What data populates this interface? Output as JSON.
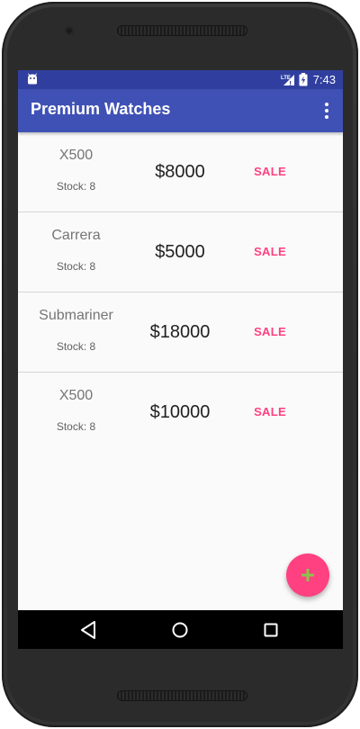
{
  "status_bar": {
    "time": "7:43",
    "network_label": "LTE",
    "icons": [
      "android-icon",
      "lte-signal-icon",
      "battery-charging-icon"
    ]
  },
  "app_bar": {
    "title": "Premium Watches",
    "overflow_icon": "more-vert-icon"
  },
  "products": [
    {
      "name": "X500",
      "stock": "Stock: 8",
      "price": "$8000",
      "sale_label": "SALE"
    },
    {
      "name": "Carrera",
      "stock": "Stock: 8",
      "price": "$5000",
      "sale_label": "SALE"
    },
    {
      "name": "Submariner",
      "stock": "Stock: 8",
      "price": "$18000",
      "sale_label": "SALE"
    },
    {
      "name": "X500",
      "stock": "Stock: 8",
      "price": "$10000",
      "sale_label": "SALE"
    }
  ],
  "fab": {
    "icon": "add-icon"
  },
  "navigation": {
    "icons": [
      "back-icon",
      "home-icon",
      "recents-icon"
    ]
  },
  "colors": {
    "primary": "#3f51b5",
    "primary_dark": "#303f9f",
    "accent": "#ff4081",
    "fab_plus": "#8bc34a"
  }
}
